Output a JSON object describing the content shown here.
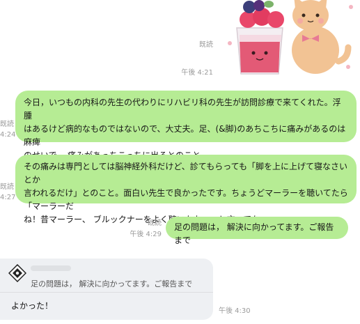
{
  "sticker": {
    "name": "cat-and-strawberry-parfait"
  },
  "messages": [
    {
      "read": "既読",
      "time": "午後 4:21"
    },
    {
      "lines": [
        "今日，いつもの内科の先生の代わりにリハビリ科の先生が訪問診療で来てくれた。浮腫",
        "はあるけど病的なものではないので、大丈夫。足、(&脚)のあちこちに痛みがあるのは麻痺",
        "のせいで、 痛みがあっちこっちに出るとのこと。"
      ],
      "read_clip": "既読",
      "time_clip": "4:24"
    },
    {
      "lines": [
        "その痛みは専門としては脳神経外科だけど、診てもらっても「脚を上に上げて寝なさいとか",
        "言われるだけ」とのこと。面白い先生で良かったです。ちょうどマーラーを聴いてたら「マーラーだ",
        "ね！昔マーラー、 ブルックナーをよく聴いたなぁ」と言ってた。"
      ],
      "read_clip": "既読",
      "time_clip": "4:27"
    },
    {
      "text": "足の問題は， 解決に向かってます。ご報告まで",
      "read": "既読",
      "time": "午後 4:29"
    }
  ],
  "reply": {
    "quote": "足の問題は， 解決に向かってます。ご報告まで",
    "text": "よかった！",
    "time": "午後 4:30"
  },
  "colors": {
    "sent_bubble": "#b6ec94",
    "received_bubble": "#eef0f3",
    "meta_text": "#9a9a9a"
  }
}
